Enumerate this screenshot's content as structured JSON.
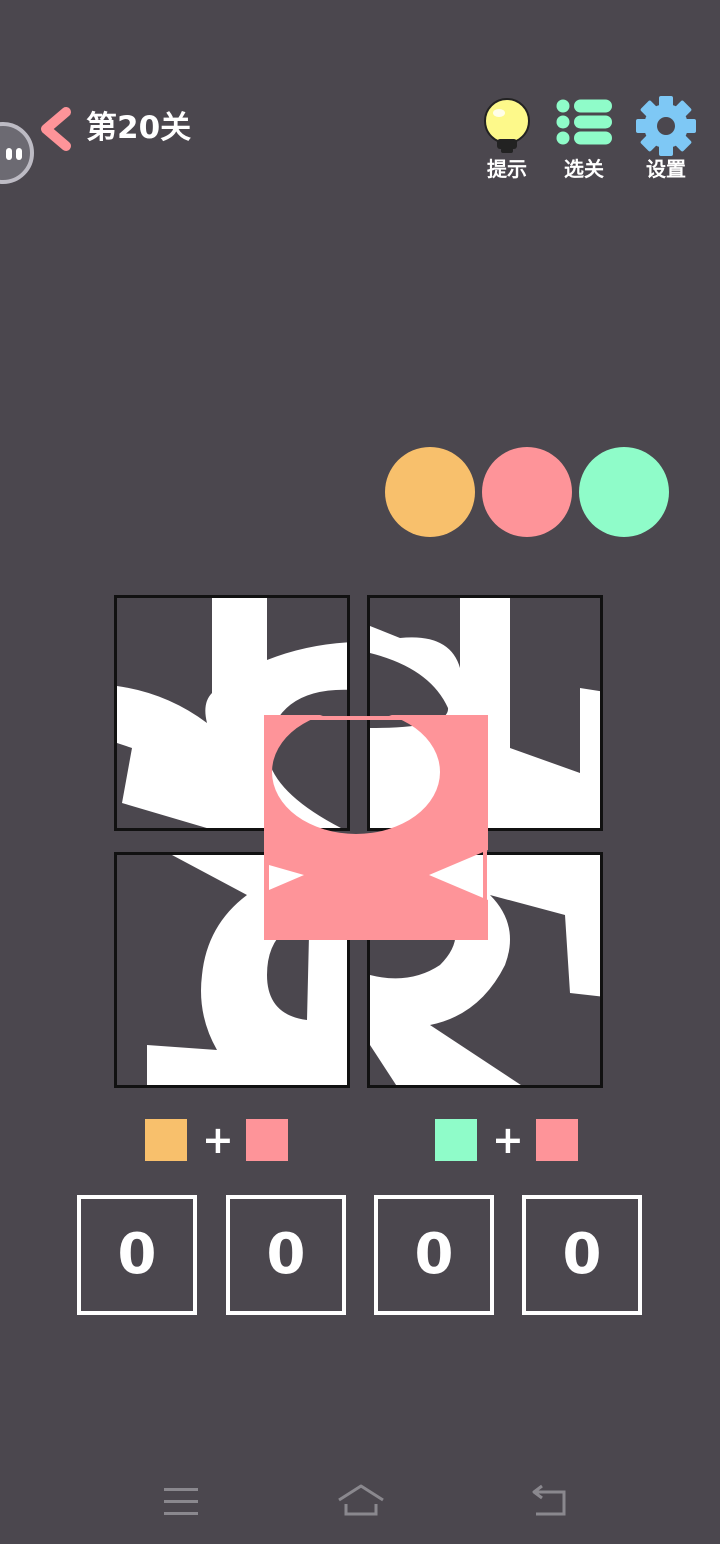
{
  "header": {
    "level_title": "第20关",
    "buttons": [
      {
        "id": "hint",
        "label": "提示",
        "icon": "lightbulb-icon",
        "color": "#fdf98a"
      },
      {
        "id": "select",
        "label": "选关",
        "icon": "list-icon",
        "color": "#8ffcc9"
      },
      {
        "id": "settings",
        "label": "设置",
        "icon": "gear-icon",
        "color": "#7ec8f5"
      }
    ]
  },
  "palette": {
    "colors": [
      "#f8c06c",
      "#fe9499",
      "#8ffcc9"
    ]
  },
  "equations": [
    {
      "left_color": "#f8c06c",
      "operator": "+",
      "right_color": "#fe9499"
    },
    {
      "left_color": "#8ffcc9",
      "operator": "+",
      "right_color": "#fe9499"
    }
  ],
  "answer": {
    "digits": [
      "0",
      "0",
      "0",
      "0"
    ]
  },
  "overlay_color": "#fe9499"
}
